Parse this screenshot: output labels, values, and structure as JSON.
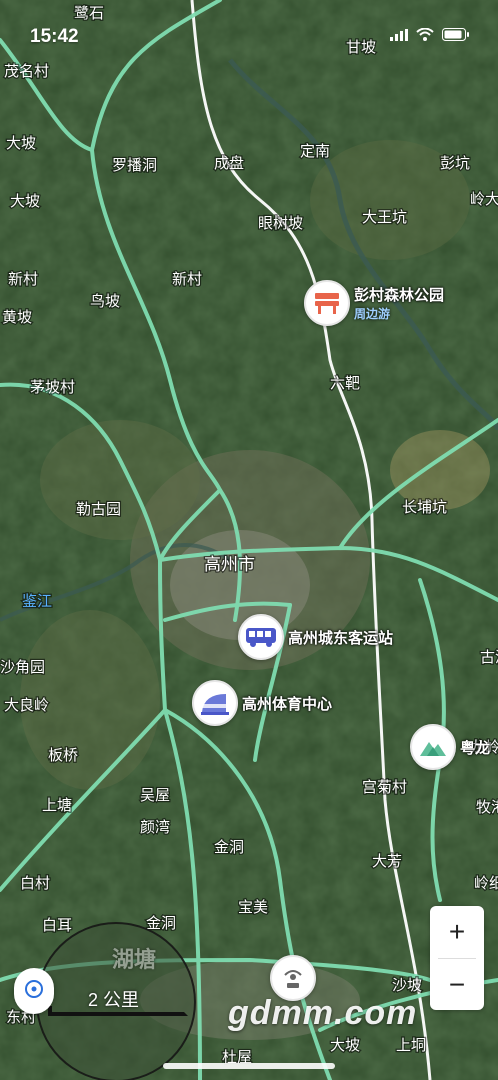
{
  "status_bar": {
    "time": "15:42"
  },
  "map": {
    "city_label": "高州市",
    "town_label": "湖塘",
    "river_label": "鉴江",
    "place_labels": [
      "鹭石",
      "甘坡",
      "茂名村",
      "大坡",
      "罗播洞",
      "成盘",
      "定南",
      "彭坑",
      "大坡",
      "眼树坡",
      "大王坑",
      "新村",
      "鸟坡",
      "新村",
      "黄坡",
      "岭大坡",
      "六靶",
      "茅坡村",
      "勒古园",
      "长埔坑",
      "沙角园",
      "大良岭",
      "板桥",
      "上塘",
      "吴屋",
      "颜湾",
      "金洞",
      "宫菊村",
      "龙岭",
      "牧港",
      "白耳",
      "金洞",
      "宝美",
      "大芳",
      "沙坡",
      "上垌",
      "白村",
      "古港",
      "东村",
      "大坡",
      "杜屋",
      "岭细"
    ],
    "colors": {
      "road": "#7fdcb0",
      "forest": "#2f4a2c",
      "farmland": "#5c6e45",
      "urban": "#8a8a80"
    }
  },
  "pois": {
    "park": {
      "name": "彭村森林公园",
      "tag": "周边游",
      "icon": "bench-icon"
    },
    "bus_station": {
      "name": "高州城东客运站",
      "icon": "bus-icon"
    },
    "stadium": {
      "name": "高州体育中心",
      "icon": "stadium-icon"
    },
    "mountain": {
      "name": "粤龙",
      "icon": "mountain-icon"
    },
    "landmark": {
      "icon": "tower-icon"
    }
  },
  "controls": {
    "zoom_in": "+",
    "zoom_out": "−",
    "scale_text": "2 公里"
  },
  "watermark": "gdmm.com"
}
